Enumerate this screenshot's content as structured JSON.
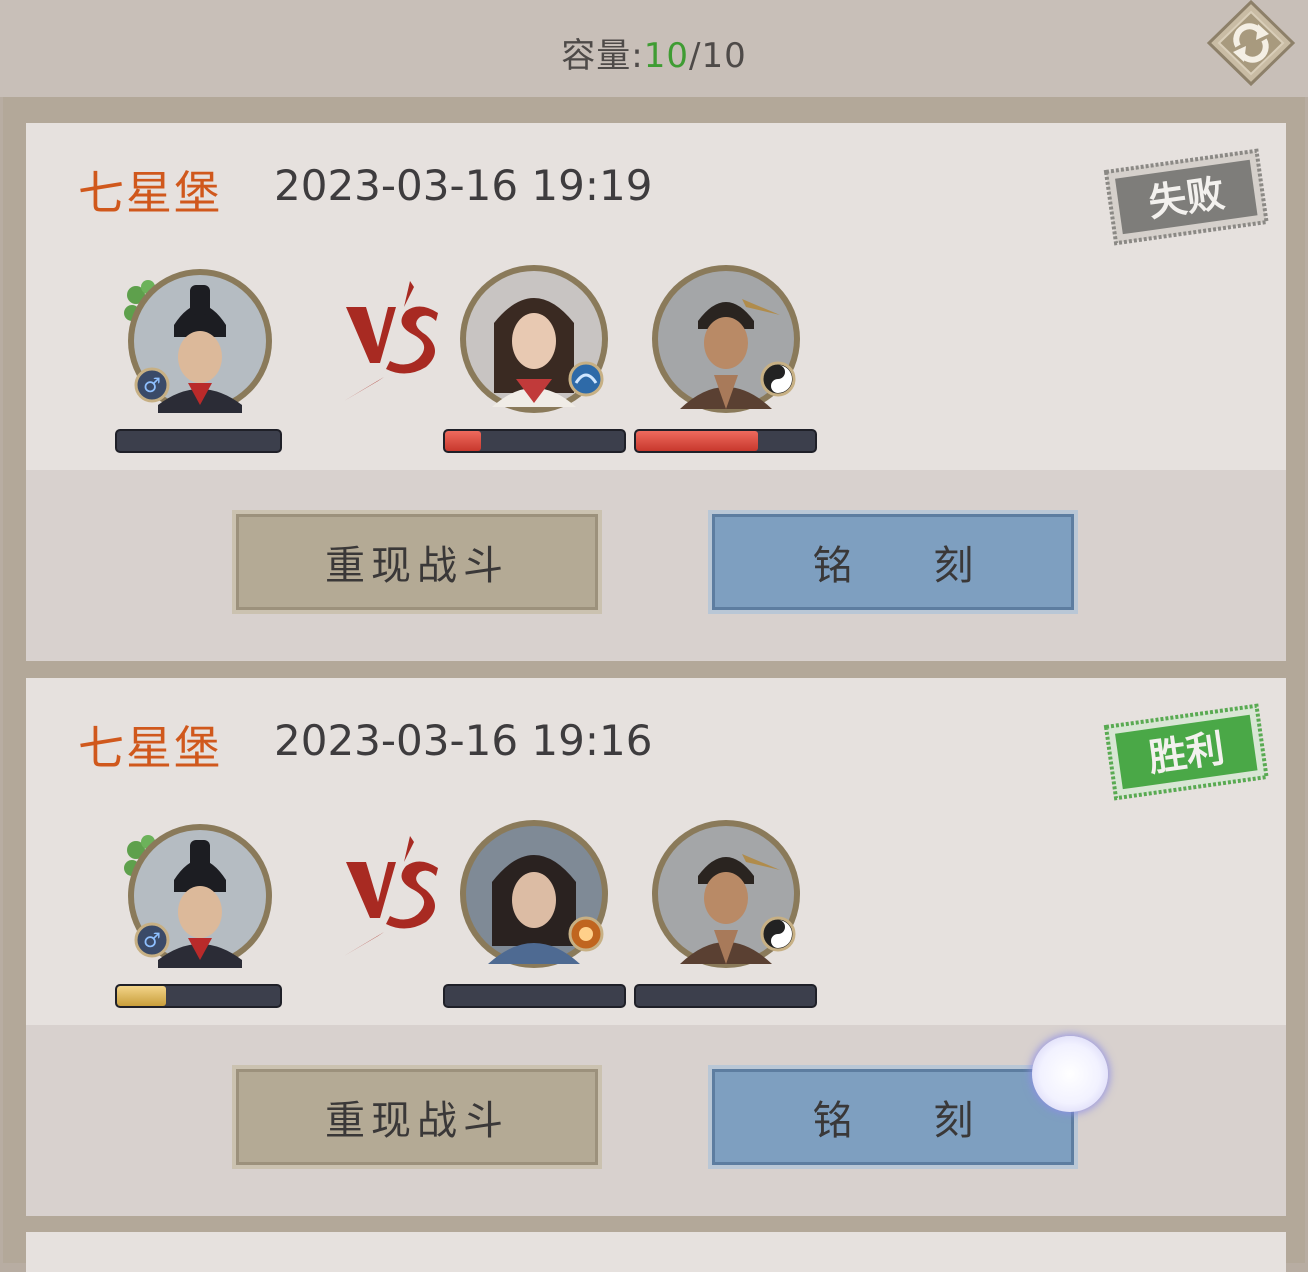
{
  "header": {
    "capacity_label": "容量:",
    "capacity_current": "10",
    "capacity_total": "/10"
  },
  "records": [
    {
      "place": "七星堡",
      "time": "2023-03-16 19:19",
      "result": "失败",
      "result_color": "#7a7a78",
      "player_hp": 0,
      "opponents": [
        {
          "hp": 0.2,
          "badge": "water-school-icon"
        },
        {
          "hp": 0.68,
          "badge": "yin-yang-icon"
        }
      ],
      "buttons": {
        "replay": "重现战斗",
        "engrave": "铭 刻"
      }
    },
    {
      "place": "七星堡",
      "time": "2023-03-16 19:16",
      "result": "胜利",
      "result_color": "#4aa847",
      "player_hp": 0.3,
      "opponents": [
        {
          "hp": 0,
          "badge": "fist-school-icon"
        },
        {
          "hp": 0,
          "badge": "yin-yang-icon"
        }
      ],
      "buttons": {
        "replay": "重现战斗",
        "engrave": "铭 刻"
      }
    }
  ],
  "colors": {
    "place": "#d0581c",
    "victory_green": "#4aa847",
    "defeat_gray": "#7a7a78",
    "vs_red": "#a82a22"
  }
}
